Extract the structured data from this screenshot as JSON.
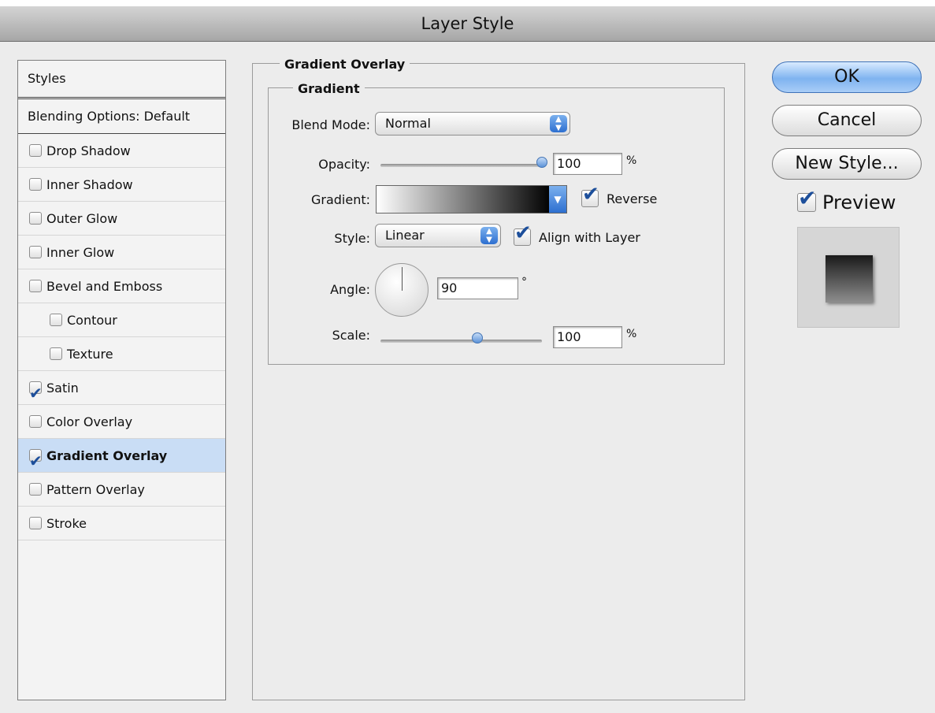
{
  "window": {
    "title": "Layer Style"
  },
  "styles_list": {
    "header": "Styles",
    "blending": "Blending Options: Default",
    "items": [
      {
        "label": "Drop Shadow",
        "checked": false,
        "indent": false,
        "selected": false
      },
      {
        "label": "Inner Shadow",
        "checked": false,
        "indent": false,
        "selected": false
      },
      {
        "label": "Outer Glow",
        "checked": false,
        "indent": false,
        "selected": false
      },
      {
        "label": "Inner Glow",
        "checked": false,
        "indent": false,
        "selected": false
      },
      {
        "label": "Bevel and Emboss",
        "checked": false,
        "indent": false,
        "selected": false
      },
      {
        "label": "Contour",
        "checked": false,
        "indent": true,
        "selected": false
      },
      {
        "label": "Texture",
        "checked": false,
        "indent": true,
        "selected": false
      },
      {
        "label": "Satin",
        "checked": true,
        "indent": false,
        "selected": false
      },
      {
        "label": "Color Overlay",
        "checked": false,
        "indent": false,
        "selected": false
      },
      {
        "label": "Gradient Overlay",
        "checked": true,
        "indent": false,
        "selected": true
      },
      {
        "label": "Pattern Overlay",
        "checked": false,
        "indent": false,
        "selected": false
      },
      {
        "label": "Stroke",
        "checked": false,
        "indent": false,
        "selected": false
      }
    ]
  },
  "panel": {
    "title": "Gradient Overlay",
    "group_title": "Gradient",
    "blend_mode": {
      "label": "Blend Mode:",
      "value": "Normal"
    },
    "opacity": {
      "label": "Opacity:",
      "value": "100",
      "unit": "%",
      "level": 100
    },
    "gradient": {
      "label": "Gradient:",
      "reverse_label": "Reverse",
      "reverse_checked": true
    },
    "style": {
      "label": "Style:",
      "value": "Linear",
      "align_label": "Align with Layer",
      "align_checked": true
    },
    "angle": {
      "label": "Angle:",
      "value": "90",
      "unit": "°"
    },
    "scale": {
      "label": "Scale:",
      "value": "100",
      "unit": "%",
      "level": 60
    }
  },
  "buttons": {
    "ok": "OK",
    "cancel": "Cancel",
    "new_style": "New Style..."
  },
  "preview": {
    "label": "Preview",
    "checked": true
  }
}
